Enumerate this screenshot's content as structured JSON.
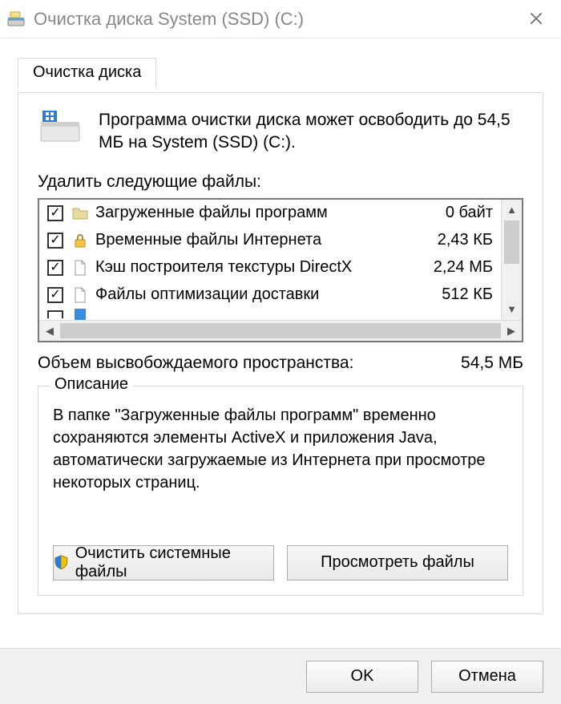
{
  "window": {
    "title": "Очистка диска System (SSD) (C:)"
  },
  "tab": {
    "label": "Очистка диска"
  },
  "intro": "Программа очистки диска может освободить до 54,5 МБ на System (SSD) (C:).",
  "files_label": "Удалить следующие файлы:",
  "items": [
    {
      "checked": true,
      "icon": "folder",
      "name": "Загруженные файлы программ",
      "size": "0 байт"
    },
    {
      "checked": true,
      "icon": "lock",
      "name": "Временные файлы Интернета",
      "size": "2,43 КБ"
    },
    {
      "checked": true,
      "icon": "file",
      "name": "Кэш построителя текстуры DirectX",
      "size": "2,24 МБ"
    },
    {
      "checked": true,
      "icon": "file",
      "name": "Файлы оптимизации доставки",
      "size": "512 КБ"
    }
  ],
  "total": {
    "label": "Объем высвобождаемого пространства:",
    "value": "54,5 МБ"
  },
  "description": {
    "legend": "Описание",
    "text": "В папке \"Загруженные файлы программ\" временно сохраняются элементы ActiveX и приложения Java, автоматически загружаемые из Интернета при просмотре некоторых страниц."
  },
  "buttons": {
    "cleanup_system": "Очистить системные файлы",
    "view_files": "Просмотреть файлы",
    "ok": "OK",
    "cancel": "Отмена"
  }
}
